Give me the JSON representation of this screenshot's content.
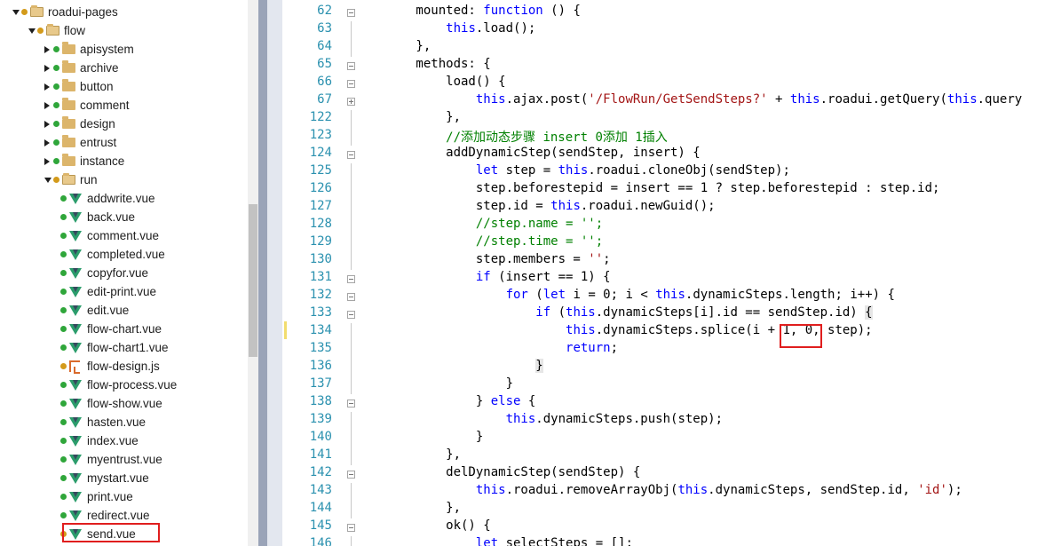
{
  "tree": {
    "rows": [
      {
        "label": "roadui-pages",
        "kind": "folder",
        "expanded": true,
        "dot": "orange",
        "indent": 0
      },
      {
        "label": "flow",
        "kind": "folder",
        "expanded": true,
        "dot": "orange",
        "indent": 1
      },
      {
        "label": "apisystem",
        "kind": "folder",
        "expanded": false,
        "dot": "green",
        "indent": 2
      },
      {
        "label": "archive",
        "kind": "folder",
        "expanded": false,
        "dot": "green",
        "indent": 2
      },
      {
        "label": "button",
        "kind": "folder",
        "expanded": false,
        "dot": "green",
        "indent": 2
      },
      {
        "label": "comment",
        "kind": "folder",
        "expanded": false,
        "dot": "green",
        "indent": 2
      },
      {
        "label": "design",
        "kind": "folder",
        "expanded": false,
        "dot": "green",
        "indent": 2
      },
      {
        "label": "entrust",
        "kind": "folder",
        "expanded": false,
        "dot": "green",
        "indent": 2
      },
      {
        "label": "instance",
        "kind": "folder",
        "expanded": false,
        "dot": "green",
        "indent": 2
      },
      {
        "label": "run",
        "kind": "folder",
        "expanded": true,
        "dot": "orange",
        "indent": 2
      },
      {
        "label": "addwrite.vue",
        "kind": "vue",
        "dot": "green",
        "indent": 3
      },
      {
        "label": "back.vue",
        "kind": "vue",
        "dot": "green",
        "indent": 3
      },
      {
        "label": "comment.vue",
        "kind": "vue",
        "dot": "green",
        "indent": 3
      },
      {
        "label": "completed.vue",
        "kind": "vue",
        "dot": "green",
        "indent": 3
      },
      {
        "label": "copyfor.vue",
        "kind": "vue",
        "dot": "green",
        "indent": 3
      },
      {
        "label": "edit-print.vue",
        "kind": "vue",
        "dot": "green",
        "indent": 3
      },
      {
        "label": "edit.vue",
        "kind": "vue",
        "dot": "green",
        "indent": 3
      },
      {
        "label": "flow-chart.vue",
        "kind": "vue",
        "dot": "green",
        "indent": 3
      },
      {
        "label": "flow-chart1.vue",
        "kind": "vue",
        "dot": "green",
        "indent": 3
      },
      {
        "label": "flow-design.js",
        "kind": "js",
        "dot": "orange",
        "indent": 3
      },
      {
        "label": "flow-process.vue",
        "kind": "vue",
        "dot": "green",
        "indent": 3
      },
      {
        "label": "flow-show.vue",
        "kind": "vue",
        "dot": "green",
        "indent": 3
      },
      {
        "label": "hasten.vue",
        "kind": "vue",
        "dot": "green",
        "indent": 3
      },
      {
        "label": "index.vue",
        "kind": "vue",
        "dot": "green",
        "indent": 3
      },
      {
        "label": "myentrust.vue",
        "kind": "vue",
        "dot": "green",
        "indent": 3
      },
      {
        "label": "mystart.vue",
        "kind": "vue",
        "dot": "green",
        "indent": 3
      },
      {
        "label": "print.vue",
        "kind": "vue",
        "dot": "green",
        "indent": 3
      },
      {
        "label": "redirect.vue",
        "kind": "vue",
        "dot": "green",
        "indent": 3
      },
      {
        "label": "send.vue",
        "kind": "vue",
        "dot": "orange",
        "indent": 3,
        "highlighted": true
      }
    ]
  },
  "editor": {
    "lines": [
      {
        "num": "62",
        "fold": "minus",
        "parts": [
          [
            "",
            "        mounted: "
          ],
          [
            "kw",
            "function"
          ],
          [
            "",
            " () {"
          ]
        ]
      },
      {
        "num": "63",
        "parts": [
          [
            "",
            "            "
          ],
          [
            "kw",
            "this"
          ],
          [
            "",
            ".load();"
          ]
        ]
      },
      {
        "num": "64",
        "parts": [
          [
            "",
            "        },"
          ]
        ]
      },
      {
        "num": "65",
        "fold": "minus",
        "parts": [
          [
            "",
            "        methods: {"
          ]
        ]
      },
      {
        "num": "66",
        "fold": "minus",
        "parts": [
          [
            "",
            "            load() {"
          ]
        ]
      },
      {
        "num": "67",
        "fold": "plus",
        "parts": [
          [
            "",
            "                "
          ],
          [
            "kw",
            "this"
          ],
          [
            "",
            ".ajax.post("
          ],
          [
            "str",
            "'/FlowRun/GetSendSteps?'"
          ],
          [
            "",
            " + "
          ],
          [
            "kw",
            "this"
          ],
          [
            "",
            ".roadui.getQuery("
          ],
          [
            "kw",
            "this"
          ],
          [
            "",
            ".query"
          ]
        ]
      },
      {
        "num": "122",
        "parts": [
          [
            "",
            "            },"
          ]
        ]
      },
      {
        "num": "123",
        "parts": [
          [
            "",
            "            "
          ],
          [
            "cm",
            "//添加动态步骤 insert 0添加 1插入"
          ]
        ]
      },
      {
        "num": "124",
        "fold": "minus",
        "parts": [
          [
            "",
            "            addDynamicStep(sendStep, insert) {"
          ]
        ]
      },
      {
        "num": "125",
        "parts": [
          [
            "",
            "                "
          ],
          [
            "kw",
            "let"
          ],
          [
            "",
            " step = "
          ],
          [
            "kw",
            "this"
          ],
          [
            "",
            ".roadui.cloneObj(sendStep);"
          ]
        ]
      },
      {
        "num": "126",
        "parts": [
          [
            "",
            "                step.beforestepid = insert == 1 ? step.beforestepid : step.id;"
          ]
        ]
      },
      {
        "num": "127",
        "parts": [
          [
            "",
            "                step.id = "
          ],
          [
            "kw",
            "this"
          ],
          [
            "",
            ".roadui.newGuid();"
          ]
        ]
      },
      {
        "num": "128",
        "parts": [
          [
            "",
            "                "
          ],
          [
            "cm",
            "//step.name = '';"
          ]
        ]
      },
      {
        "num": "129",
        "parts": [
          [
            "",
            "                "
          ],
          [
            "cm",
            "//step.time = '';"
          ]
        ]
      },
      {
        "num": "130",
        "parts": [
          [
            "",
            "                step.members = "
          ],
          [
            "str",
            "''"
          ],
          [
            "",
            ";"
          ]
        ]
      },
      {
        "num": "131",
        "fold": "minus",
        "parts": [
          [
            "",
            "                "
          ],
          [
            "kw",
            "if"
          ],
          [
            "",
            " (insert == 1) {"
          ]
        ]
      },
      {
        "num": "132",
        "fold": "minus",
        "parts": [
          [
            "",
            "                    "
          ],
          [
            "kw",
            "for"
          ],
          [
            "",
            " ("
          ],
          [
            "kw",
            "let"
          ],
          [
            "",
            " i = 0; i < "
          ],
          [
            "kw",
            "this"
          ],
          [
            "",
            ".dynamicSteps.length; i++) {"
          ]
        ]
      },
      {
        "num": "133",
        "fold": "minus",
        "parts": [
          [
            "",
            "                        "
          ],
          [
            "kw",
            "if"
          ],
          [
            "",
            " ("
          ],
          [
            "kw",
            "this"
          ],
          [
            "",
            ".dynamicSteps[i].id == sendStep.id) "
          ],
          [
            "bh",
            "{"
          ]
        ]
      },
      {
        "num": "134",
        "parts": [
          [
            "",
            "                            "
          ],
          [
            "kw",
            "this"
          ],
          [
            "",
            ".dynamicSteps.splice(i + 1, 0, step);"
          ]
        ]
      },
      {
        "num": "135",
        "parts": [
          [
            "",
            "                            "
          ],
          [
            "kw",
            "return"
          ],
          [
            "",
            ";"
          ]
        ]
      },
      {
        "num": "136",
        "parts": [
          [
            "",
            "                        "
          ],
          [
            "bh",
            "}"
          ]
        ]
      },
      {
        "num": "137",
        "parts": [
          [
            "",
            "                    }"
          ]
        ]
      },
      {
        "num": "138",
        "fold": "minus",
        "parts": [
          [
            "",
            "                } "
          ],
          [
            "kw",
            "else"
          ],
          [
            "",
            " {"
          ]
        ]
      },
      {
        "num": "139",
        "parts": [
          [
            "",
            "                    "
          ],
          [
            "kw",
            "this"
          ],
          [
            "",
            ".dynamicSteps.push(step);"
          ]
        ]
      },
      {
        "num": "140",
        "parts": [
          [
            "",
            "                }"
          ]
        ]
      },
      {
        "num": "141",
        "parts": [
          [
            "",
            "            },"
          ]
        ]
      },
      {
        "num": "142",
        "fold": "minus",
        "parts": [
          [
            "",
            "            delDynamicStep(sendStep) {"
          ]
        ]
      },
      {
        "num": "143",
        "parts": [
          [
            "",
            "                "
          ],
          [
            "kw",
            "this"
          ],
          [
            "",
            ".roadui.removeArrayObj("
          ],
          [
            "kw",
            "this"
          ],
          [
            "",
            ".dynamicSteps, sendStep.id, "
          ],
          [
            "str",
            "'id'"
          ],
          [
            "",
            ");"
          ]
        ]
      },
      {
        "num": "144",
        "parts": [
          [
            "",
            "            },"
          ]
        ]
      },
      {
        "num": "145",
        "fold": "minus",
        "parts": [
          [
            "",
            "            ok() {"
          ]
        ]
      },
      {
        "num": "146",
        "parts": [
          [
            "",
            "                "
          ],
          [
            "kw",
            "let"
          ],
          [
            "",
            " selectSteps = [];"
          ]
        ]
      }
    ]
  }
}
